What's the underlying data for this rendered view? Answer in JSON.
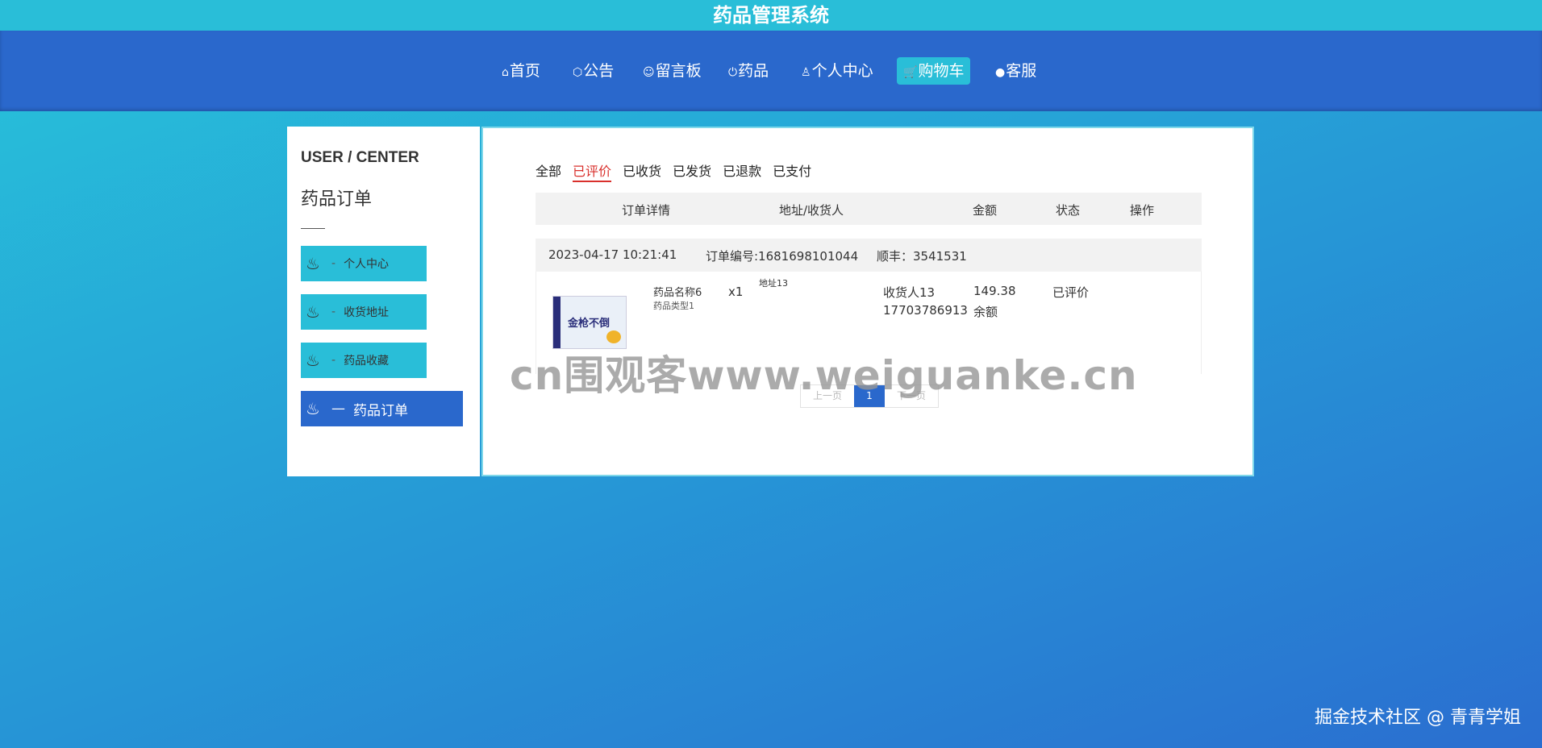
{
  "app_title": "药品管理系统",
  "nav": [
    {
      "label": "首页",
      "icon": "home-icon",
      "glyph": "⌂"
    },
    {
      "label": "公告",
      "icon": "cube-icon",
      "glyph": "⬡"
    },
    {
      "label": "留言板",
      "icon": "smile-icon",
      "glyph": "☺"
    },
    {
      "label": "药品",
      "icon": "power-icon",
      "glyph": "⏻"
    },
    {
      "label": "个人中心",
      "icon": "user-icon",
      "glyph": "♙"
    },
    {
      "label": "购物车",
      "icon": "cart-icon",
      "glyph": "🛒"
    },
    {
      "label": "客服",
      "icon": "wechat-icon",
      "glyph": "●"
    }
  ],
  "nav_active": "购物车",
  "sidebar": {
    "heading": "USER / CENTER",
    "subtitle": "药品订单",
    "items": [
      {
        "label": "个人中心",
        "dash": "-"
      },
      {
        "label": "收货地址",
        "dash": "-"
      },
      {
        "label": "药品收藏",
        "dash": "-"
      },
      {
        "label": "药品订单",
        "dash": "—"
      }
    ],
    "active": "药品订单"
  },
  "tabs": [
    "全部",
    "已评价",
    "已收货",
    "已发货",
    "已退款",
    "已支付"
  ],
  "active_tab": "已评价",
  "table_headers": [
    "订单详情",
    "地址/收货人",
    "金额",
    "状态",
    "操作"
  ],
  "order": {
    "time": "2023-04-17 10:21:41",
    "order_no": "订单编号:1681698101044",
    "express": "顺丰：3541531",
    "product_name": "药品名称6",
    "product_type": "药品类型1",
    "quantity": "x1",
    "address": "地址13",
    "receiver": "收货人13",
    "phone": "17703786913",
    "amount": "149.38",
    "pay_method": "余额",
    "status": "已评价",
    "image_text": "金枪不倒"
  },
  "pagination": {
    "prev": "上一页",
    "current": "1",
    "next": "下一页"
  },
  "watermark": "cn围观客www.weiguanke.cn",
  "footer": "掘金技术社区 @ 青青学姐",
  "colors": {
    "accent": "#2a68cc",
    "cyan": "#29bed8",
    "active_tab": "#d9302c"
  }
}
